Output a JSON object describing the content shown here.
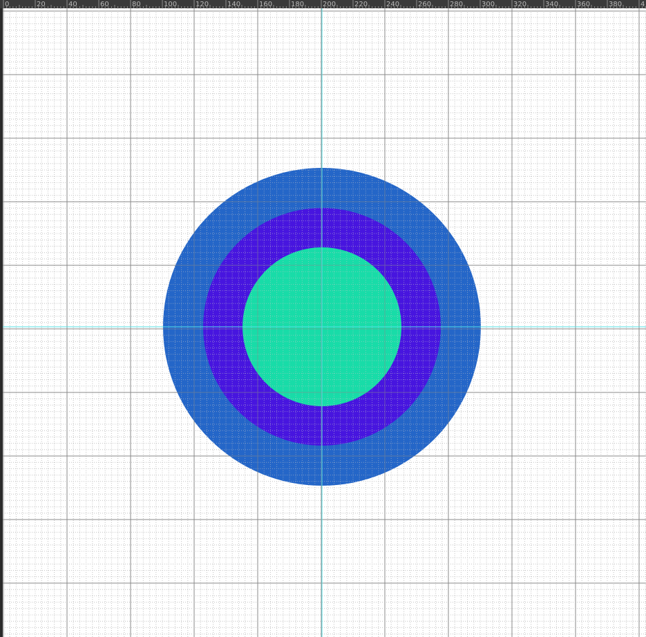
{
  "ruler": {
    "labels": [
      "0",
      "20",
      "40",
      "60",
      "80",
      "100",
      "120",
      "140",
      "160",
      "180",
      "200",
      "220",
      "240",
      "260",
      "280",
      "300",
      "320",
      "340",
      "360",
      "380",
      "4"
    ]
  },
  "colors": {
    "ruler_bg": "#3a3a3a",
    "ruler_text": "#b8b8b8",
    "canvas_bg": "#ffffff",
    "grid_minor": "#c8c8c8",
    "grid_major": "#8a8a8a",
    "guide": "#55e0e6",
    "ring_outer": "#2466c8",
    "ring_middle": "#4715df",
    "ring_inner": "#18dca8"
  },
  "shapes": [
    {
      "name": "outer-circle",
      "color_key": "ring_outer"
    },
    {
      "name": "middle-circle",
      "color_key": "ring_middle"
    },
    {
      "name": "inner-circle",
      "color_key": "ring_inner"
    }
  ]
}
